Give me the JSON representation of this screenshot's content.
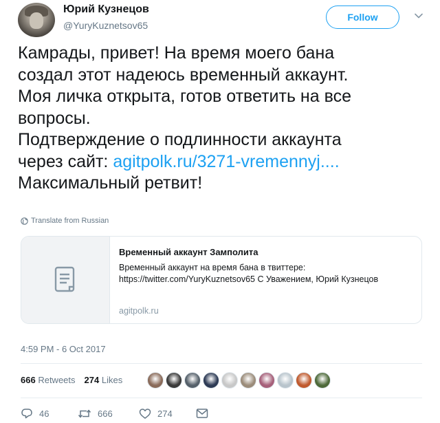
{
  "author": {
    "display_name": "Юрий Кузнецов",
    "handle": "@YuryKuznetsov65"
  },
  "follow_button": {
    "label": "Follow"
  },
  "tweet": {
    "lines": [
      "Камрады, привет! На время моего бана",
      "создал этот надеюсь временный аккаунт.",
      "Моя личка открыта, готов ответить на все",
      "вопросы.",
      "Подтверждение о подлинности аккаунта"
    ],
    "link_prefix": "через сайт: ",
    "link_text": "agitpolk.ru/3271-vremennyj....",
    "last_line": "Максимальный ретвит!"
  },
  "translate_label": "Translate from Russian",
  "card": {
    "title": "Временный аккаунт Замполита",
    "description": "Временный аккаунт на время бана в твиттере: https://twitter.com/YuryKuznetsov65 С Уважением, Юрий Кузнецов",
    "domain": "agitpolk.ru"
  },
  "timestamp": "4:59 PM - 6 Oct 2017",
  "stats": {
    "retweets_count": "666",
    "retweets_label": "Retweets",
    "likes_count": "274",
    "likes_label": "Likes"
  },
  "likers": [
    {
      "color": "#8a6b5a",
      "icon": "avatar"
    },
    {
      "color": "#3a3a3a",
      "icon": "avatar"
    },
    {
      "color": "#55606a",
      "icon": "avatar"
    },
    {
      "color": "#2e3b55",
      "icon": "avatar"
    },
    {
      "color": "#c8c8c8",
      "icon": "avatar"
    },
    {
      "color": "#9b8c7a",
      "icon": "avatar"
    },
    {
      "color": "#a6607a",
      "icon": "avatar"
    },
    {
      "color": "#b8c4cc",
      "icon": "avatar"
    },
    {
      "color": "#c05a2e",
      "icon": "avatar"
    },
    {
      "color": "#4e6a3a",
      "icon": "avatar"
    }
  ],
  "actions": {
    "reply_count": "46",
    "retweet_count": "666",
    "like_count": "274"
  },
  "colors": {
    "accent": "#1da1f2",
    "secondary_text": "#657786"
  }
}
